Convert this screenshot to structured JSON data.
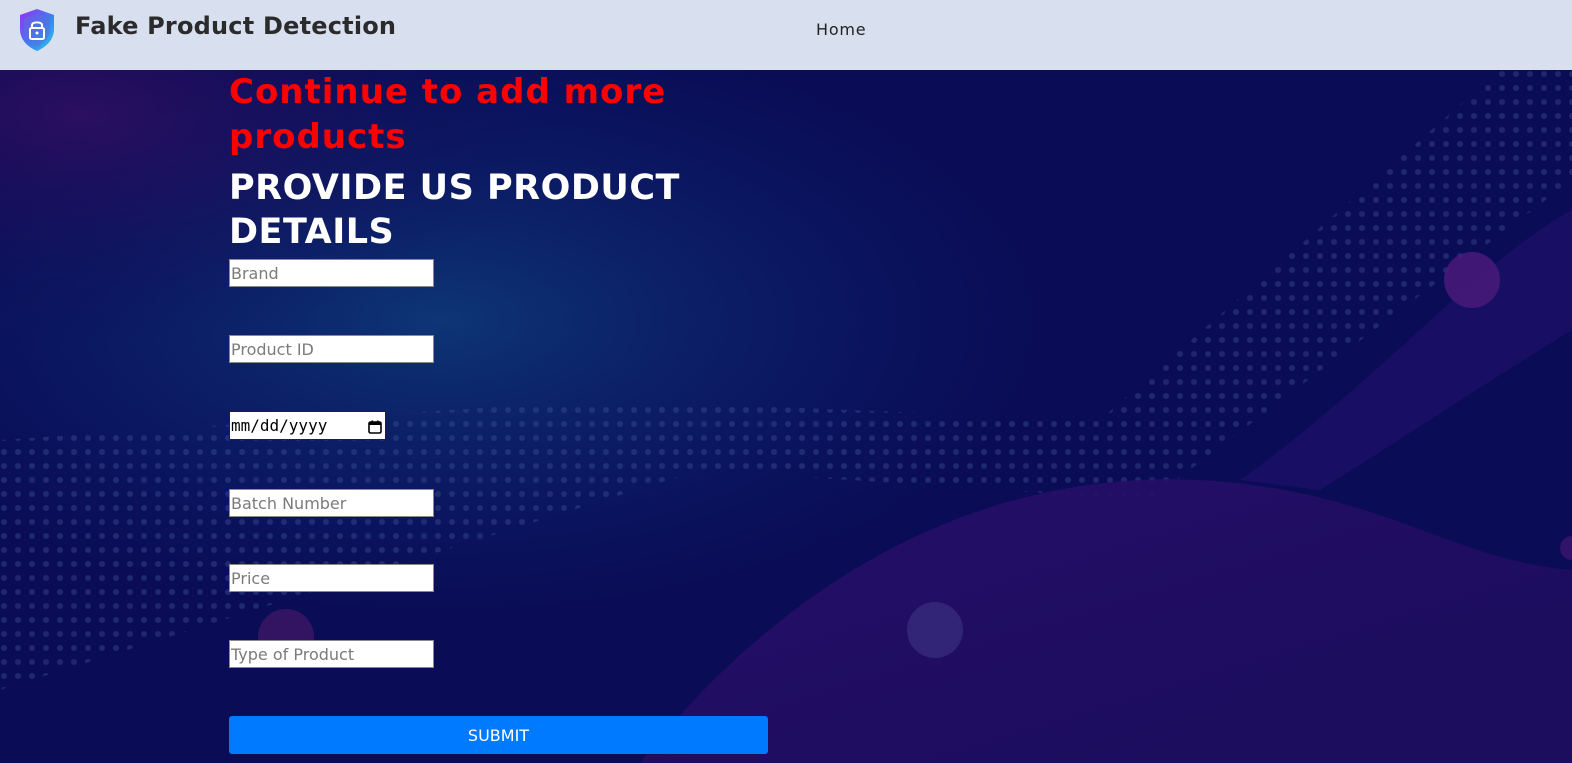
{
  "header": {
    "title": "Fake Product Detection",
    "nav": {
      "home_label": "Home"
    }
  },
  "main": {
    "headline": "Continue to add more products",
    "subheading": "PROVIDE US PRODUCT DETAILS",
    "form": {
      "brand_placeholder": "Brand",
      "product_id_placeholder": "Product ID",
      "date_placeholder": "mm/dd/yyyy",
      "batch_number_placeholder": "Batch Number",
      "price_placeholder": "Price",
      "product_type_placeholder": "Type of Product",
      "submit_label": "SUBMIT"
    }
  },
  "colors": {
    "header_bg": "#d8dfef",
    "page_bg": "#0a0c55",
    "headline": "#ff0000",
    "subheading": "#ffffff",
    "submit_bg": "#007bff"
  },
  "icons": {
    "logo": "shield-lock-icon",
    "date_picker": "calendar-icon"
  }
}
